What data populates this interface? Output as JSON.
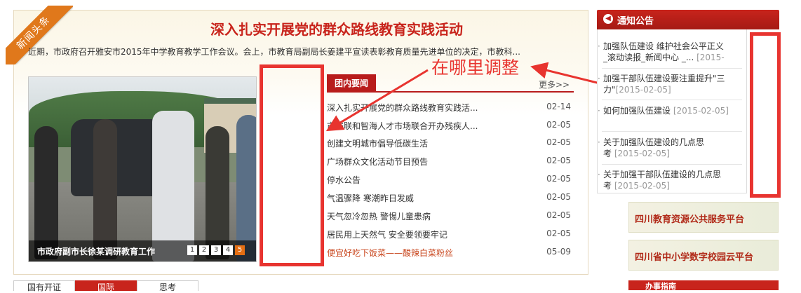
{
  "headline_panel": {
    "ribbon_label": "新闻头条",
    "headline": "深入扎实开展党的群众路线教育实践活动",
    "summary": "近期，市政府召开雅安市2015年中学教育教学工作会议。会上，市教育局副局长姜建平宣读表彰教育质量先进单位的决定，市教科..."
  },
  "slideshow": {
    "caption": "市政府副市长徐某调研教育工作",
    "pages": [
      "1",
      "2",
      "3",
      "4",
      "5"
    ],
    "active_page": "5"
  },
  "news_tab": {
    "label": "团内要闻",
    "more": "更多>>",
    "items": [
      {
        "title": "深入扎实开展党的群众路线教育实践活...",
        "date": "02-14"
      },
      {
        "title": "市残联和智海人才市场联合开办残疾人...",
        "date": "02-05"
      },
      {
        "title": "创建文明城市倡导低碳生活",
        "date": "02-05"
      },
      {
        "title": "广场群众文化活动节目预告",
        "date": "02-05"
      },
      {
        "title": "停水公告",
        "date": "02-05"
      },
      {
        "title": "气温骤降 寒潮昨日发威",
        "date": "02-05"
      },
      {
        "title": "天气忽冷忽热 警惕儿童患病",
        "date": "02-05"
      },
      {
        "title": "居民用上天然气 安全要领要牢记",
        "date": "02-05"
      },
      {
        "title": "便宜好吃下饭菜——酸辣白菜粉丝",
        "date": "05-09"
      }
    ]
  },
  "annotation": {
    "text": "在哪里调整",
    "color": "#e8342f"
  },
  "notice": {
    "title": "通知公告",
    "items": [
      {
        "line1": "加强队伍建设 维护社会公平正义",
        "line2": "_滚动读报_新闻中心 _...",
        "date": "[2015-"
      },
      {
        "line1": "加强干部队伍建设要注重提升\"三",
        "line2": "力\"",
        "date": "[2015-02-05]"
      },
      {
        "line1": "如何加强队伍建设",
        "line2": "",
        "date": "[2015-02-05]"
      },
      {
        "line1": "关于加强队伍建设的几点思",
        "line2": "考",
        "date": "[2015-02-05]"
      },
      {
        "line1": "关于加强干部队伍建设的几点思",
        "line2": "考",
        "date": "[2015-02-05]"
      }
    ]
  },
  "banners": [
    {
      "text": "四川教育资源公共服务平台"
    },
    {
      "text": "四川省中小学数字校园云平台"
    }
  ],
  "bottom_tabs": [
    {
      "label": "国有开证"
    },
    {
      "label": "国际"
    },
    {
      "label": "思考"
    }
  ],
  "bottom_right_label": "办事指南",
  "colors": {
    "brand_red": "#c8241c",
    "accent_orange": "#e0781b",
    "annotation_red": "#e8342f"
  }
}
